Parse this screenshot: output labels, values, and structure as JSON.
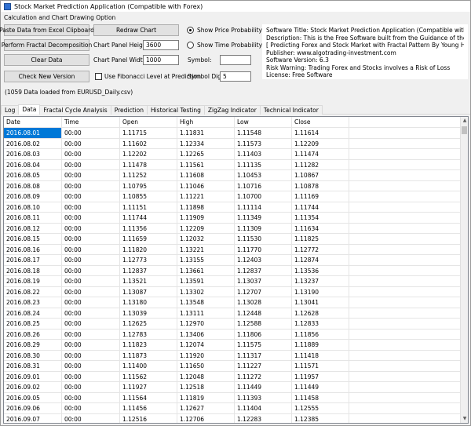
{
  "window": {
    "title": "Stock Market Prediction Application (Compatible with Forex)"
  },
  "menu": {
    "item": "Calculation and Chart Drawing Option"
  },
  "buttons": {
    "paste": "Paste Data from Excel Clipboard",
    "fractal": "Perform Fractal Decomposition",
    "clear": "Clear Data",
    "check": "Check New Version",
    "redraw": "Redraw Chart"
  },
  "fields": {
    "panel_height_label": "Chart Panel Height:",
    "panel_height": "3600",
    "panel_width_label": "Chart Panel Width:",
    "panel_width": "1000",
    "symbol_label": "Symbol:",
    "symbol": "",
    "digit_label": "Symbol Digit:",
    "digit": "5"
  },
  "options": {
    "price_prob": "Show Price Probability",
    "time_prob": "Show Time Probability",
    "fibonacci": "Use Fibonacci Level at Prediction"
  },
  "status": "(1059 Data loaded from EURUSD_Daily.csv)",
  "info": [
    "Software Title: Stock Market Prediction Application (Compatible with Forex)",
    "Description: This is the Free Software built from the Guidance of the Book",
    "[ Predicting Forex and Stock Market with Fractal Pattern By Young Ho Seo ]",
    "Publisher: www.algotrading-investment.com",
    "Software Version: 6.3",
    "Risk Warning: Trading Forex and Stocks involves a Risk of Loss",
    "License: Free Software"
  ],
  "tabs": [
    "Log",
    "Data",
    "Fractal Cycle Analysis",
    "Prediction",
    "Historical Testing",
    "ZigZag Indicator",
    "Technical Indicator"
  ],
  "table": {
    "headers": [
      "Date",
      "Time",
      "Open",
      "High",
      "Low",
      "Close"
    ],
    "rows": [
      [
        "2016.08.01",
        "00:00",
        "1.11715",
        "1.11831",
        "1.11548",
        "1.11614"
      ],
      [
        "2016.08.02",
        "00:00",
        "1.11602",
        "1.12334",
        "1.11573",
        "1.12209"
      ],
      [
        "2016.08.03",
        "00:00",
        "1.12202",
        "1.12265",
        "1.11403",
        "1.11474"
      ],
      [
        "2016.08.04",
        "00:00",
        "1.11478",
        "1.11561",
        "1.11135",
        "1.11282"
      ],
      [
        "2016.08.05",
        "00:00",
        "1.11252",
        "1.11608",
        "1.10453",
        "1.10867"
      ],
      [
        "2016.08.08",
        "00:00",
        "1.10795",
        "1.11046",
        "1.10716",
        "1.10878"
      ],
      [
        "2016.08.09",
        "00:00",
        "1.10855",
        "1.11221",
        "1.10700",
        "1.11169"
      ],
      [
        "2016.08.10",
        "00:00",
        "1.11151",
        "1.11898",
        "1.11114",
        "1.11744"
      ],
      [
        "2016.08.11",
        "00:00",
        "1.11744",
        "1.11909",
        "1.11349",
        "1.11354"
      ],
      [
        "2016.08.12",
        "00:00",
        "1.11356",
        "1.12209",
        "1.11309",
        "1.11634"
      ],
      [
        "2016.08.15",
        "00:00",
        "1.11659",
        "1.12032",
        "1.11530",
        "1.11825"
      ],
      [
        "2016.08.16",
        "00:00",
        "1.11820",
        "1.13221",
        "1.11770",
        "1.12772"
      ],
      [
        "2016.08.17",
        "00:00",
        "1.12773",
        "1.13155",
        "1.12403",
        "1.12874"
      ],
      [
        "2016.08.18",
        "00:00",
        "1.12837",
        "1.13661",
        "1.12837",
        "1.13536"
      ],
      [
        "2016.08.19",
        "00:00",
        "1.13521",
        "1.13591",
        "1.13037",
        "1.13237"
      ],
      [
        "2016.08.22",
        "00:00",
        "1.13087",
        "1.13302",
        "1.12707",
        "1.13190"
      ],
      [
        "2016.08.23",
        "00:00",
        "1.13180",
        "1.13548",
        "1.13028",
        "1.13041"
      ],
      [
        "2016.08.24",
        "00:00",
        "1.13039",
        "1.13111",
        "1.12448",
        "1.12628"
      ],
      [
        "2016.08.25",
        "00:00",
        "1.12625",
        "1.12970",
        "1.12588",
        "1.12833"
      ],
      [
        "2016.08.26",
        "00:00",
        "1.12783",
        "1.13406",
        "1.11806",
        "1.11856"
      ],
      [
        "2016.08.29",
        "00:00",
        "1.11823",
        "1.12074",
        "1.11575",
        "1.11889"
      ],
      [
        "2016.08.30",
        "00:00",
        "1.11873",
        "1.11920",
        "1.11317",
        "1.11418"
      ],
      [
        "2016.08.31",
        "00:00",
        "1.11400",
        "1.11650",
        "1.11227",
        "1.11571"
      ],
      [
        "2016.09.01",
        "00:00",
        "1.11562",
        "1.12048",
        "1.11272",
        "1.11957"
      ],
      [
        "2016.09.02",
        "00:00",
        "1.11927",
        "1.12518",
        "1.11449",
        "1.11449"
      ],
      [
        "2016.09.05",
        "00:00",
        "1.11564",
        "1.11819",
        "1.11393",
        "1.11458"
      ],
      [
        "2016.09.06",
        "00:00",
        "1.11456",
        "1.12627",
        "1.11404",
        "1.12555"
      ],
      [
        "2016.09.07",
        "00:00",
        "1.12516",
        "1.12706",
        "1.12283",
        "1.12385"
      ]
    ]
  }
}
